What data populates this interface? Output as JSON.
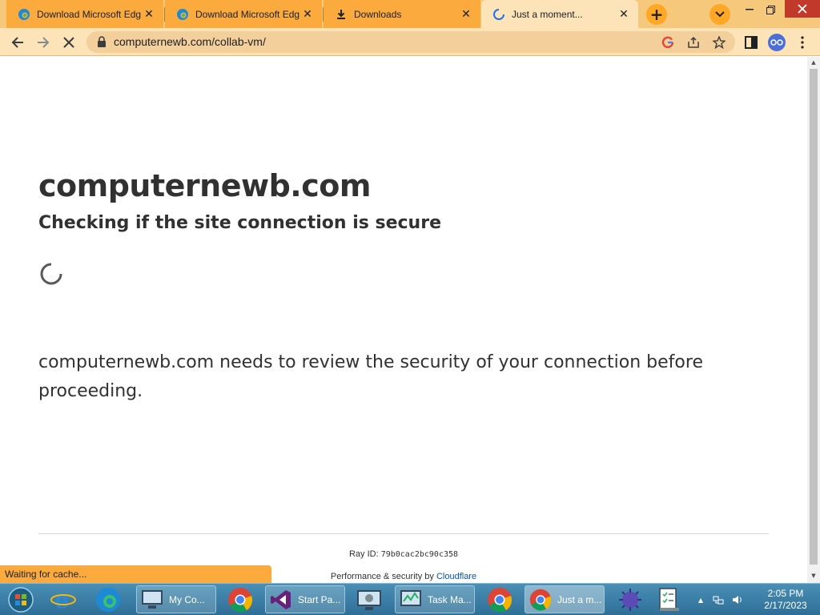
{
  "browser": {
    "tabs": [
      {
        "title": "Download Microsoft Edge",
        "icon": "edge-icon",
        "active": false
      },
      {
        "title": "Download Microsoft Edge",
        "icon": "edge-icon",
        "active": false
      },
      {
        "title": "Downloads",
        "icon": "download-icon",
        "active": false
      },
      {
        "title": "Just a moment...",
        "icon": "loading-spinner-icon",
        "active": true
      }
    ],
    "url": "computernewb.com/collab-vm/",
    "status_text": "Waiting for cache..."
  },
  "page": {
    "site_title": "computernewb.com",
    "subtitle": "Checking if the site connection is secure",
    "body": "computernewb.com needs to review the security of your connection before proceeding.",
    "ray_label": "Ray ID:",
    "ray_id": "79b0cac2bc90c358",
    "perf_label": "Performance & security by",
    "perf_link": "Cloudflare"
  },
  "taskbar": {
    "items": [
      {
        "label": "",
        "icon": "internet-explorer-icon"
      },
      {
        "label": "",
        "icon": "edge-icon"
      },
      {
        "label": "My Co...",
        "icon": "my-computer-icon"
      },
      {
        "label": "",
        "icon": "chrome-icon"
      },
      {
        "label": "Start Pa...",
        "icon": "visual-studio-icon"
      },
      {
        "label": "",
        "icon": "control-panel-icon"
      },
      {
        "label": "Task Ma...",
        "icon": "task-manager-icon"
      },
      {
        "label": "",
        "icon": "chrome-icon"
      },
      {
        "label": "Just a m...",
        "icon": "chrome-icon"
      },
      {
        "label": "",
        "icon": "virus-icon"
      },
      {
        "label": "",
        "icon": "checklist-icon"
      }
    ],
    "time": "2:05 PM",
    "date": "2/17/2023"
  },
  "colors": {
    "tabstrip": "#f5c87b",
    "active_tab": "#fde3b8",
    "link": "#0051c3",
    "text": "#313131"
  }
}
